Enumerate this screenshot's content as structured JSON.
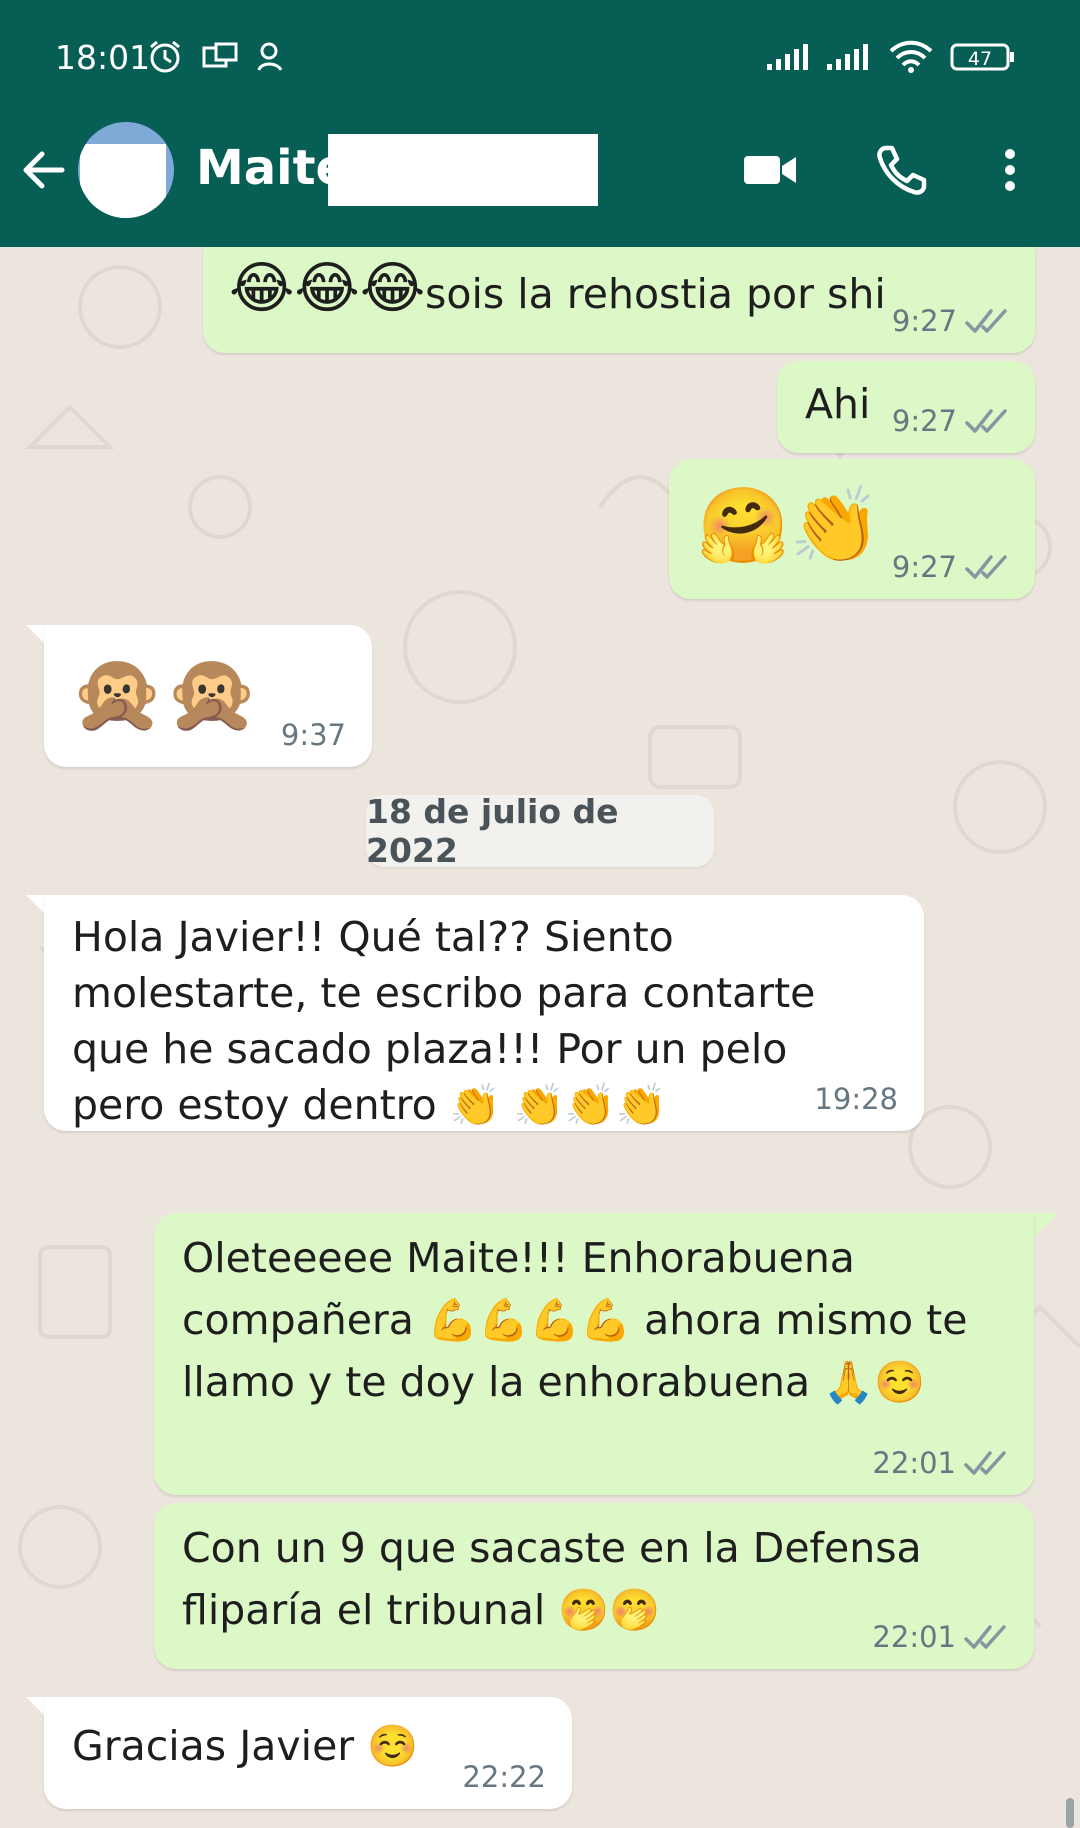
{
  "status_bar": {
    "time": "18:01",
    "battery": "47",
    "icons": [
      "alarm-icon",
      "notification-icon",
      "location-icon",
      "signal-icon",
      "signal-icon",
      "wifi-icon",
      "battery-icon"
    ]
  },
  "app_bar": {
    "contact_name": "Maite",
    "icons": [
      "back-arrow-icon",
      "video-call-icon",
      "phone-icon",
      "more-vert-icon"
    ]
  },
  "colors": {
    "header": "#075e54",
    "outgoing_bubble": "#dcf8c6",
    "incoming_bubble": "#ffffff",
    "chat_background": "#ece5dd",
    "read_ticks": "#8696a0"
  },
  "messages": [
    {
      "direction": "out",
      "emoji": "😂😂😂",
      "text": "sois la rehostia por shi",
      "time": "9:27",
      "status": "delivered"
    },
    {
      "direction": "out",
      "text": "Ahi",
      "time": "9:27",
      "status": "delivered"
    },
    {
      "direction": "out",
      "emoji": "🤗👏",
      "text": "",
      "time": "9:27",
      "status": "delivered"
    },
    {
      "direction": "in",
      "emoji": "🙊🙊",
      "text": "",
      "time": "9:37"
    },
    {
      "direction": "in",
      "text": "Hola Javier!! Qué tal?? Siento molestarte, te escribo para contarte que he sacado plaza!!! Por un pelo pero estoy dentro 👏 👏👏👏",
      "time": "19:28"
    },
    {
      "direction": "out",
      "text": "Oleteeeee Maite!!! Enhorabuena compañera 💪💪💪💪 ahora mismo te llamo y te doy la enhorabuena 🙏☺️",
      "time": "22:01",
      "status": "delivered"
    },
    {
      "direction": "out",
      "text": "Con un 9 que sacaste en la Defensa fliparía el tribunal 🤭🤭",
      "time": "22:01",
      "status": "delivered"
    },
    {
      "direction": "in",
      "text": "Gracias Javier ☺️",
      "time": "22:22"
    }
  ],
  "date_separator": "18 de julio de 2022"
}
